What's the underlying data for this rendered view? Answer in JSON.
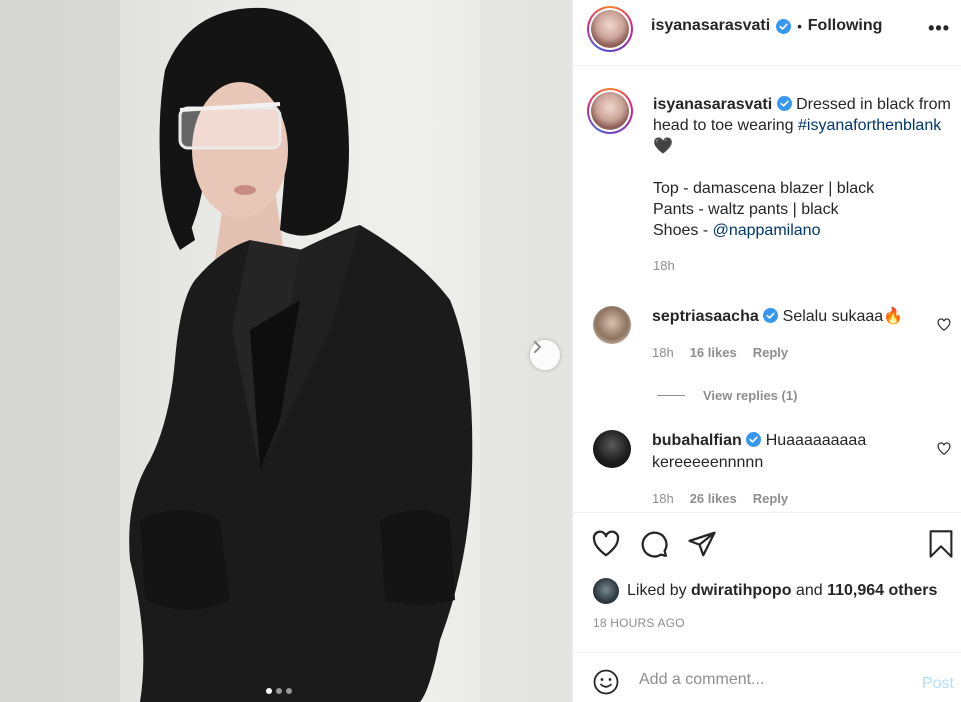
{
  "post": {
    "username": "isyanasarasvati",
    "follow_separator": "•",
    "follow_status": "Following",
    "more_label": "•••"
  },
  "caption": {
    "username": "isyanasarasvati",
    "line1_text": "Dressed in black from",
    "line2_text": "head to toe wearing",
    "hashtag": "#isyanaforthenblank",
    "line3_emoji": "🖤",
    "item1": "Top - damascena blazer | black",
    "item2": "Pants - waltz pants | black",
    "item3_prefix": "Shoes - ",
    "item3_mention": "@nappamilano",
    "time": "18h"
  },
  "comments": [
    {
      "username": "septriasaacha",
      "text": "Selalu sukaaa🔥",
      "time": "18h",
      "likes": "16 likes",
      "reply": "Reply"
    },
    {
      "username": "bubahalfian",
      "text_line1": "Huaaaaaaaaa",
      "text_line2": "kereeeeennnnn",
      "time": "18h",
      "likes": "26 likes",
      "reply": "Reply"
    }
  ],
  "view_replies": "View replies (1)",
  "likes": {
    "prefix": "Liked by ",
    "user": "dwiratihpopo",
    "middle": " and ",
    "others": "110,964 others"
  },
  "time_ago": "18 HOURS AGO",
  "add_comment": {
    "placeholder": "Add a comment...",
    "post_label": "Post"
  },
  "carousel": {
    "current": 1,
    "total": 3
  },
  "colors": {
    "link": "#00376b",
    "verified": "#3897f0",
    "muted": "#8e8e8e",
    "post_disabled": "#b2dffc"
  },
  "icons": [
    "verified-icon",
    "more-options-icon",
    "chevron-right-icon",
    "heart-icon",
    "comment-icon",
    "share-icon",
    "bookmark-icon",
    "emoji-icon"
  ]
}
